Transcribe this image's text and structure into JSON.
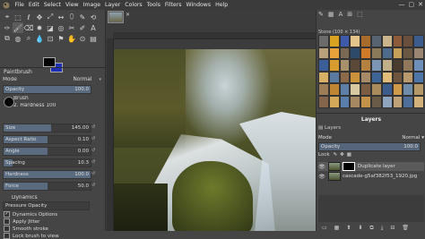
{
  "menubar": {
    "items": [
      "File",
      "Edit",
      "Select",
      "View",
      "Image",
      "Layer",
      "Colors",
      "Tools",
      "Filters",
      "Windows",
      "Help"
    ],
    "window_controls": [
      "—",
      "▢",
      "✕"
    ]
  },
  "toolbox": {
    "tools": [
      "⌖",
      "⬚",
      "ℓ",
      "✥",
      "⤢",
      "↔",
      "⬯",
      "✎",
      "⟲",
      "✑",
      "🖌",
      "⌫",
      "✹",
      "◪",
      "◎",
      "✂",
      "✐",
      "A",
      "⧉",
      "◍",
      "⌕",
      "💧",
      "⊡",
      "⚑",
      "✋",
      "⊙",
      "▤"
    ],
    "fg_color": "#000000",
    "bg_color": "#1c2fb5"
  },
  "tool_options": {
    "tab_title": "Paintbrush",
    "mode_label": "Mode",
    "mode_value": "Normal",
    "opacity_label": "Opacity",
    "opacity_value": "100.0",
    "brush_label": "Brush",
    "brush_name": "2. Hardness 100",
    "sliders": [
      {
        "label": "Size",
        "value": "145.00",
        "fill": 0.55
      },
      {
        "label": "Aspect Ratio",
        "value": "0.10",
        "fill": 0.5
      },
      {
        "label": "Angle",
        "value": "0.00",
        "fill": 0.5
      },
      {
        "label": "Spacing",
        "value": "10.3",
        "fill": 0.1
      },
      {
        "label": "Hardness",
        "value": "100.0",
        "fill": 1.0
      },
      {
        "label": "Force",
        "value": "50.0",
        "fill": 0.5
      }
    ],
    "dynamics_label": "Dynamics",
    "dynamics_value": "Pressure Opacity",
    "checks": [
      {
        "label": "Dynamics Options",
        "checked": true
      },
      {
        "label": "Apply Jitter",
        "checked": false
      },
      {
        "label": "Smooth stroke",
        "checked": false
      },
      {
        "label": "Lock brush to view",
        "checked": false
      }
    ]
  },
  "patterns": {
    "header": "Stone (100 × 134)",
    "colors": [
      "#6b6b6b",
      "#d9a321",
      "#3f5aa8",
      "#e4c48a",
      "#a96b2c",
      "#586371",
      "#c9b48c",
      "#8d5a3a",
      "#6b4f3d",
      "#3d5c8e",
      "#b7a07a",
      "#e7a23a",
      "#7a6a55",
      "#2e4a6b",
      "#d07a2a",
      "#8a7a5a",
      "#4d6b8a",
      "#c5a058",
      "#6a5842",
      "#9a8670",
      "#3b5e99",
      "#d69c2d",
      "#a8906c",
      "#5a4838",
      "#b5813f",
      "#7d96b5",
      "#c2b08a",
      "#4a3d2f",
      "#92785a",
      "#6e8fb8",
      "#d5b065",
      "#5b7aa0",
      "#8a6a48",
      "#c9923b",
      "#a78b66",
      "#3f6496",
      "#e0bd7a",
      "#6e553e",
      "#b89a6e",
      "#4e76a8",
      "#9c7d55",
      "#c08532",
      "#5d7fa8",
      "#d8c9a0",
      "#7a5d43",
      "#aa8c5c",
      "#3c5c8c",
      "#cf9a4a",
      "#6f8cab",
      "#b49868",
      "#84644a",
      "#d3a858",
      "#5a7eac",
      "#a68862",
      "#c4934a",
      "#6a5a48",
      "#8fa4bd",
      "#bfa278",
      "#4f6f9a",
      "#d2b27a"
    ]
  },
  "layers": {
    "title": "Layers",
    "mode_label": "Mode",
    "mode_value": "Normal",
    "opacity_label": "Opacity",
    "opacity_value": "100.0",
    "lock_label": "Lock",
    "items": [
      {
        "name": "Duplicate layer",
        "selected": true
      },
      {
        "name": "cascade-g5af382f53_1920.jpg",
        "selected": false
      }
    ],
    "buttons": [
      "▭",
      "▦",
      "⬆",
      "⬇",
      "⧉",
      "⤓",
      "⊟",
      "🗑"
    ]
  }
}
